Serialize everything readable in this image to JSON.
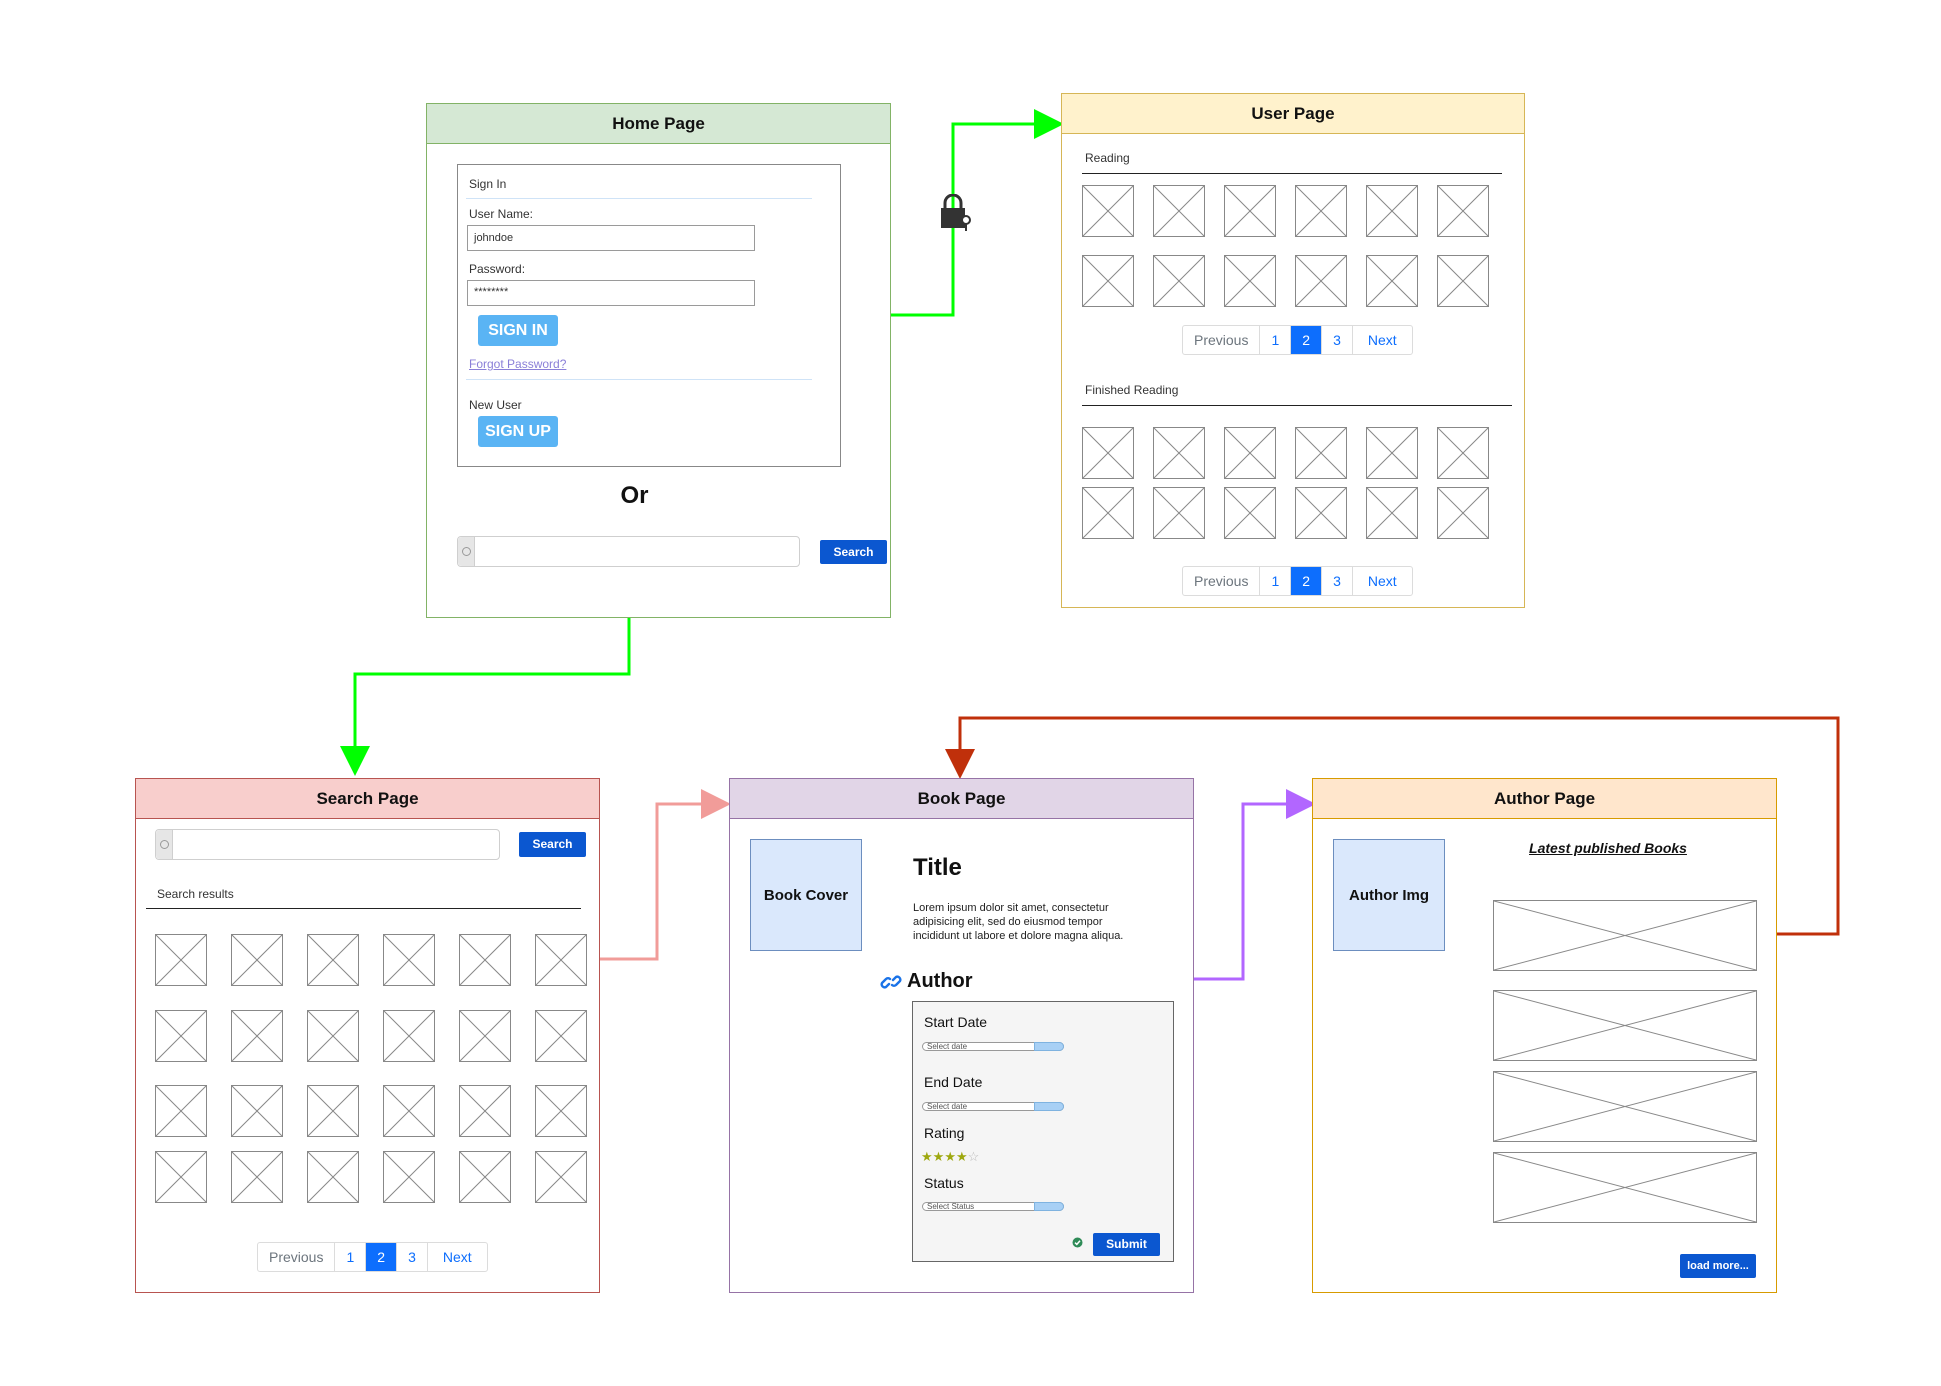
{
  "home": {
    "title": "Home Page",
    "signin_legend": "Sign In",
    "username_label": "User Name:",
    "username_value": "johndoe",
    "password_label": "Password:",
    "password_value": "********",
    "signin_button": "SIGN IN",
    "forgot_link": "Forgot Password?",
    "new_user_label": "New User",
    "signup_button": "SIGN UP",
    "or_text": "Or",
    "search_button": "Search"
  },
  "user": {
    "title": "User Page",
    "reading_label": "Reading",
    "finished_label": "Finished Reading",
    "pagination": [
      "Previous",
      "1",
      "2",
      "3",
      "Next"
    ]
  },
  "search": {
    "title": "Search Page",
    "search_button": "Search",
    "results_label": "Search results",
    "pagination": [
      "Previous",
      "1",
      "2",
      "3",
      "Next"
    ]
  },
  "book": {
    "title": "Book Page",
    "cover_label": "Book Cover",
    "book_title": "Title",
    "description": "Lorem ipsum dolor sit amet, consectetur adipisicing elit, sed do eiusmod tempor incididunt ut labore et dolore magna aliqua.",
    "author_link": "Author",
    "start_date_label": "Start Date",
    "end_date_label": "End Date",
    "date_placeholder": "Select date",
    "rating_label": "Rating",
    "rating_value": 4,
    "rating_max": 5,
    "status_label": "Status",
    "status_placeholder": "Select Status",
    "submit_button": "Submit"
  },
  "author": {
    "title": "Author Page",
    "image_label": "Author Img",
    "latest_heading": "Latest published Books",
    "load_more_button": "load more..."
  },
  "colors": {
    "home_border": "#82b366",
    "home_fill": "#d5e8d4",
    "user_border": "#d6b656",
    "user_fill": "#fff2cc",
    "search_border": "#b85450",
    "search_fill": "#f8cecc",
    "book_border": "#9673a6",
    "book_fill": "#e1d5e7",
    "author_border": "#d79b00",
    "author_fill": "#ffe6cc",
    "arrow_green": "#00ff00",
    "arrow_pink": "#f19c99",
    "arrow_purple": "#b266ff",
    "arrow_red": "#c0300b"
  },
  "icons": {
    "lock": "lock-with-key-icon",
    "link": "link-icon",
    "check": "check-circle-icon"
  }
}
